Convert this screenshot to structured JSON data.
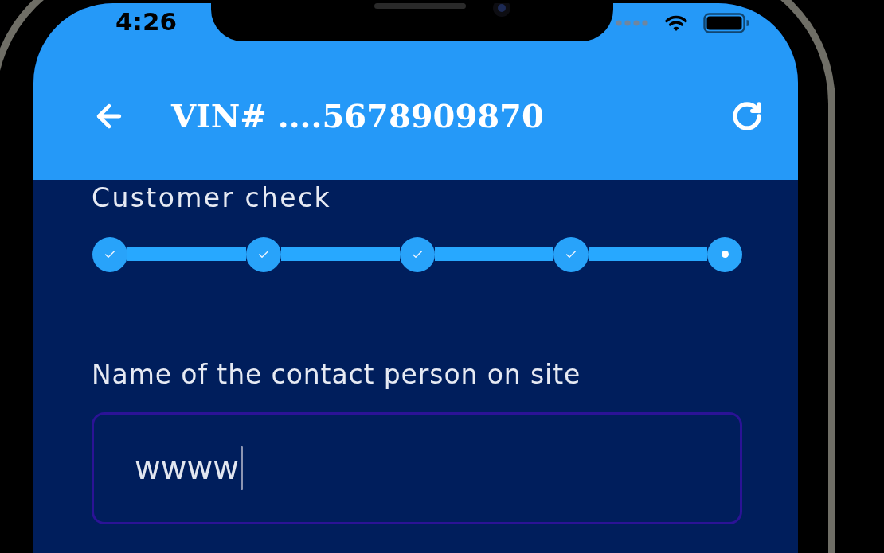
{
  "status_bar": {
    "time": "4:26"
  },
  "app_bar": {
    "title": "VIN# ....5678909870"
  },
  "stepper": {
    "title": "Customer check",
    "steps": [
      {
        "completed": true
      },
      {
        "completed": true
      },
      {
        "completed": true
      },
      {
        "completed": true
      },
      {
        "completed": false
      }
    ]
  },
  "form": {
    "field": {
      "label": "Name of the contact person on site",
      "value": "wwww",
      "focused": true
    }
  }
}
